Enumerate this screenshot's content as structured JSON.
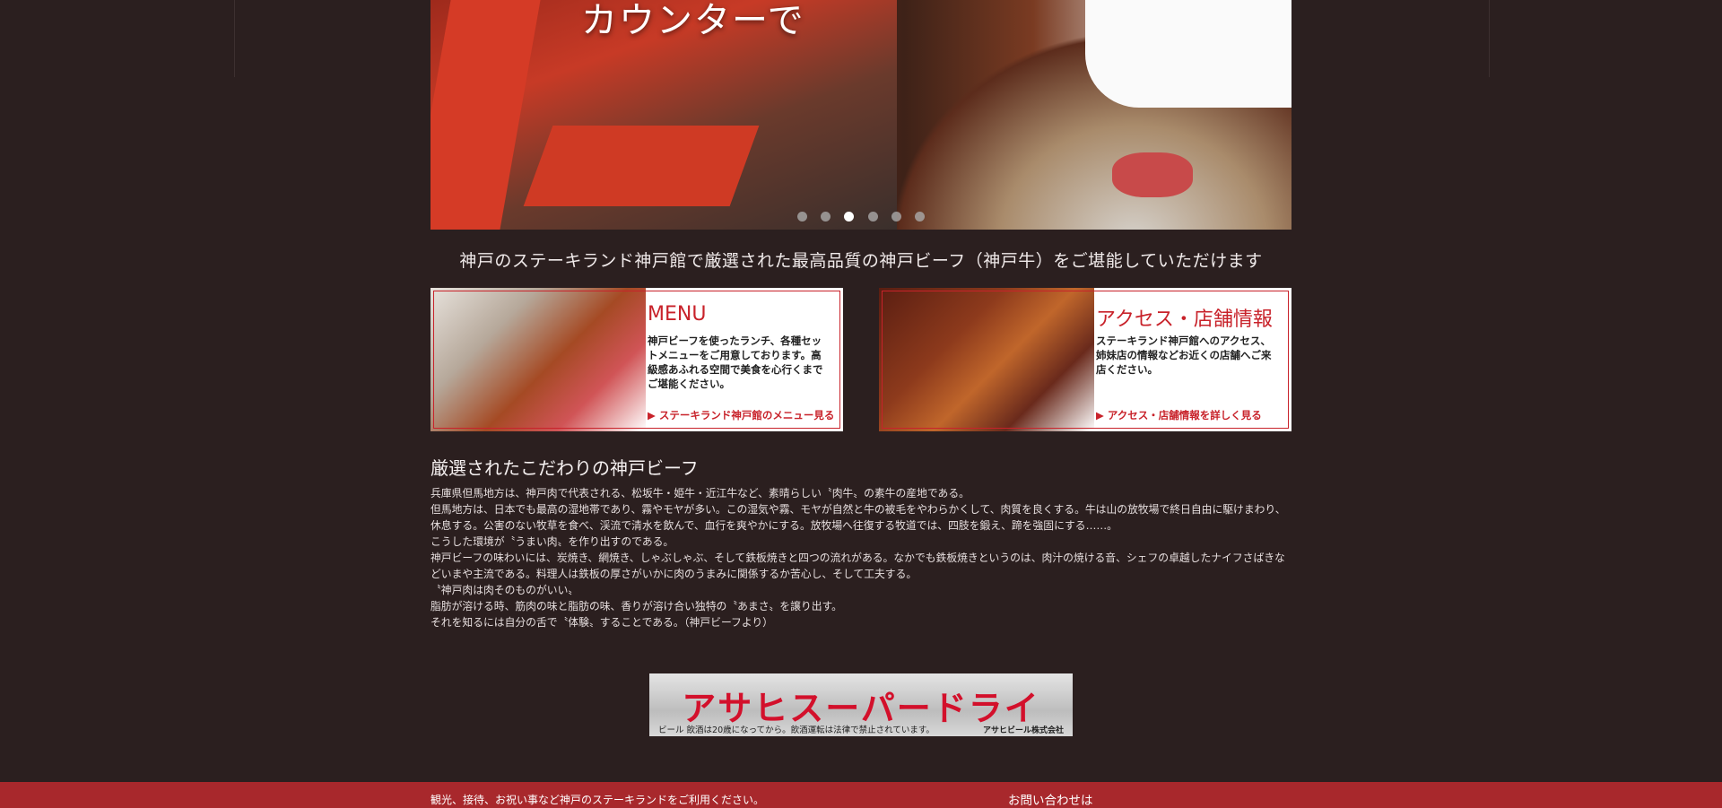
{
  "hero": {
    "caption": "カウンターで",
    "slides_count": 6,
    "active_slide": 3
  },
  "lead_text": "神戸のステーキランド神戸館で厳選された最高品質の神戸ビーフ（神戸牛）をご堪能していただけます",
  "cards": {
    "menu": {
      "title": "MENU",
      "desc": "神戸ビーフを使ったランチ、各種セットメニューをご用意しております。高級感あふれる空間で美食を心行くまでご堪能ください。",
      "link": "▶ ステーキランド神戸館のメニュー見る"
    },
    "access": {
      "title": "アクセス・店舗情報",
      "desc": "ステーキランド神戸館へのアクセス、姉妹店の情報などお近くの店舗へご来店ください。",
      "link": "▶ アクセス・店舗情報を詳しく見る"
    }
  },
  "section": {
    "heading": "厳選されたこだわりの神戸ビーフ",
    "paragraphs": [
      "兵庫県但馬地方は、神戸肉で代表される、松坂牛・姫牛・近江牛など、素晴らしい〝肉牛〟の素牛の産地である。",
      "但馬地方は、日本でも最高の湿地帯であり、霧やモヤが多い。この湿気や霧、モヤが自然と牛の被毛をやわらかくして、肉質を良くする。牛は山の放牧場で終日自由に駆けまわり、休息する。公害のない牧草を食べ、渓流で清水を飲んで、血行を爽やかにする。放牧場へ往復する牧道では、四肢を鍛え、蹄を強固にする……。",
      "こうした環境が〝うまい肉〟を作り出すのである。",
      "神戸ビーフの味わいには、炭焼き、網焼き、しゃぶしゃぶ、そして鉄板焼きと四つの流れがある。なかでも鉄板焼きというのは、肉汁の焼ける音、シェフの卓越したナイフさばきなどいまや主流である。料理人は鉄板の厚さがいかに肉のうまみに関係するか苦心し、そして工夫する。",
      "〝神戸肉は肉そのものがいい〟",
      "脂肪が溶ける時、筋肉の味と脂肪の味、香りが溶け合い独特の〝あまさ〟を譲り出す。",
      "それを知るには自分の舌で〝体験〟することである。（神戸ビーフより）"
    ]
  },
  "banner": {
    "brand": "アサヒスーパードライ",
    "warning": "ビール 飲酒は20歳になってから。飲酒運転は法律で禁止されています。",
    "maker": "アサヒビール株式会社"
  },
  "footer": {
    "left": "観光、接待、お祝い事など神戸のステーキランドをご利用ください。",
    "right": "お問い合わせは"
  }
}
